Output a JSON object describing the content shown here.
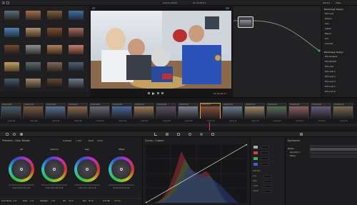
{
  "topbar": {
    "title": "Scene 00426",
    "timecode": "01:24:48:27",
    "menu": [
      "Library",
      "Clips"
    ]
  },
  "viewer": {
    "timecode": "01:02:44:17"
  },
  "lut_panel": {
    "section1_title": "Blackmagic Design",
    "section1_items": [
      "Film Look",
      "DaVinci",
      "Cine",
      "Classic",
      "Bleach",
      "LUT",
      "Contrast"
    ],
    "section2_title": "Blackmagic Design",
    "section2_items": [
      "Film Gradient",
      "Film Rec709",
      "Film Look",
      "Film Look 2",
      "Film Look 3",
      "Film Look 4",
      "Film Look 5",
      "Film Look 6"
    ]
  },
  "timeline": {
    "clips": [
      {
        "tc": "01:02:31:08",
        "name": "Scene 01"
      },
      {
        "tc": "01:02:33:19",
        "name": "Scene 02"
      },
      {
        "tc": "01:02:35:02",
        "name": "Scene 03"
      },
      {
        "tc": "01:02:36:11",
        "name": "Scene 04"
      },
      {
        "tc": "01:02:38:22",
        "name": "Scene 05"
      },
      {
        "tc": "01:02:40:06",
        "name": "Scene 06"
      },
      {
        "tc": "01:02:41:17",
        "name": "Scene 07"
      },
      {
        "tc": "01:02:42:28",
        "name": "Scene 08"
      },
      {
        "tc": "01:02:43:09",
        "name": "Scene 09"
      },
      {
        "tc": "01:02:44:17",
        "name": "Scene 10"
      },
      {
        "tc": "01:02:45:24",
        "name": "Scene 11"
      },
      {
        "tc": "01:02:47:03",
        "name": "Scene 12"
      },
      {
        "tc": "01:02:48:14",
        "name": "Scene 13"
      },
      {
        "tc": "01:02:49:25",
        "name": "Scene 14"
      },
      {
        "tc": "01:02:51:07",
        "name": "Scene 15"
      },
      {
        "tc": "01:02:52:18",
        "name": "Scene 16"
      }
    ]
  },
  "wheels": {
    "panel_title": "Primaries - Color Wheels",
    "contrast_label": "Contrast",
    "contrast_value": "1.000",
    "pivot_label": "Pivot",
    "pivot_value": "0.435",
    "wheel_names": [
      "Lift",
      "Gamma",
      "Gain",
      "Offset"
    ],
    "wheel_values": [
      "0.00  0.00  0.00  0.00",
      "0.00  0.00  0.00  0.00",
      "1.00  1.00  1.00  1.00",
      "25.00  25.00  25.00"
    ],
    "footer": [
      "Color Boost",
      "0.00",
      "Shad",
      "0.00",
      "Highlight",
      "0.00",
      "Sat",
      "50.00",
      "Hue",
      "50.00",
      "Lum Mix",
      "100.00"
    ]
  },
  "curves": {
    "panel_title": "Curves - Custom"
  },
  "mid": {
    "labels": [
      "Soft Clip",
      "Low",
      "High",
      "L.Soft",
      "H.Soft"
    ]
  },
  "keyframes": {
    "panel_title": "Keyframes",
    "rows": [
      "Master",
      "Corrector 1",
      "Sizing"
    ]
  },
  "colors": {
    "accent": "#e0a040",
    "red": "#d04040",
    "green": "#40b050",
    "blue": "#4060d0"
  }
}
